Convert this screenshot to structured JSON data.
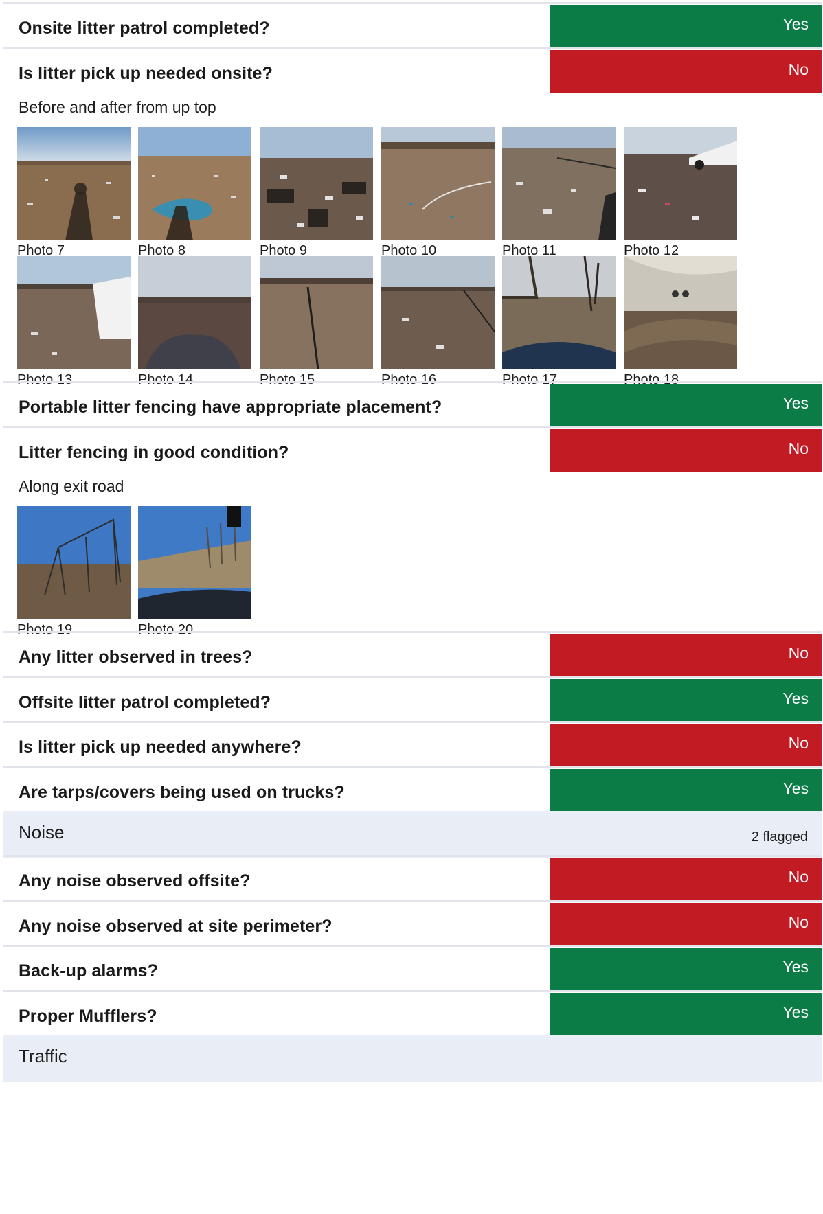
{
  "litter": [
    {
      "question": "Onsite litter patrol completed?",
      "answer": "Yes"
    },
    {
      "question": "Is litter pick up needed onsite?",
      "answer": "No"
    },
    {
      "question": "Portable litter fencing have appropriate placement?",
      "answer": "Yes"
    },
    {
      "question": "Litter fencing in good condition?",
      "answer": "No"
    },
    {
      "question": "Any litter observed in trees?",
      "answer": "No"
    },
    {
      "question": "Offsite litter patrol completed?",
      "answer": "Yes"
    },
    {
      "question": "Is litter pick up needed anywhere?",
      "answer": "No"
    },
    {
      "question": "Are tarps/covers being used on trucks?",
      "answer": "Yes"
    }
  ],
  "notes": {
    "pickup_note": "Before and after from up top",
    "fencing_note": "Along exit road"
  },
  "photos_pickup": [
    {
      "caption": "Photo 7"
    },
    {
      "caption": "Photo 8"
    },
    {
      "caption": "Photo 9"
    },
    {
      "caption": "Photo 10"
    },
    {
      "caption": "Photo 11"
    },
    {
      "caption": "Photo 12"
    },
    {
      "caption": "Photo 13"
    },
    {
      "caption": "Photo 14"
    },
    {
      "caption": "Photo 15"
    },
    {
      "caption": "Photo 16"
    },
    {
      "caption": "Photo 17"
    },
    {
      "caption": "Photo 18"
    }
  ],
  "photos_fencing": [
    {
      "caption": "Photo 19"
    },
    {
      "caption": "Photo 20"
    }
  ],
  "noise": {
    "title": "Noise",
    "flagged": "2 flagged",
    "items": [
      {
        "question": "Any noise observed offsite?",
        "answer": "No"
      },
      {
        "question": "Any noise observed at site perimeter?",
        "answer": "No"
      },
      {
        "question": "Back-up alarms?",
        "answer": "Yes"
      },
      {
        "question": "Proper Mufflers?",
        "answer": "Yes"
      }
    ]
  },
  "traffic": {
    "title": "Traffic"
  },
  "colors": {
    "yes": "#0b7c46",
    "no": "#c21b24",
    "section_bg": "#e9edf5",
    "divider": "#e1e5eb"
  }
}
